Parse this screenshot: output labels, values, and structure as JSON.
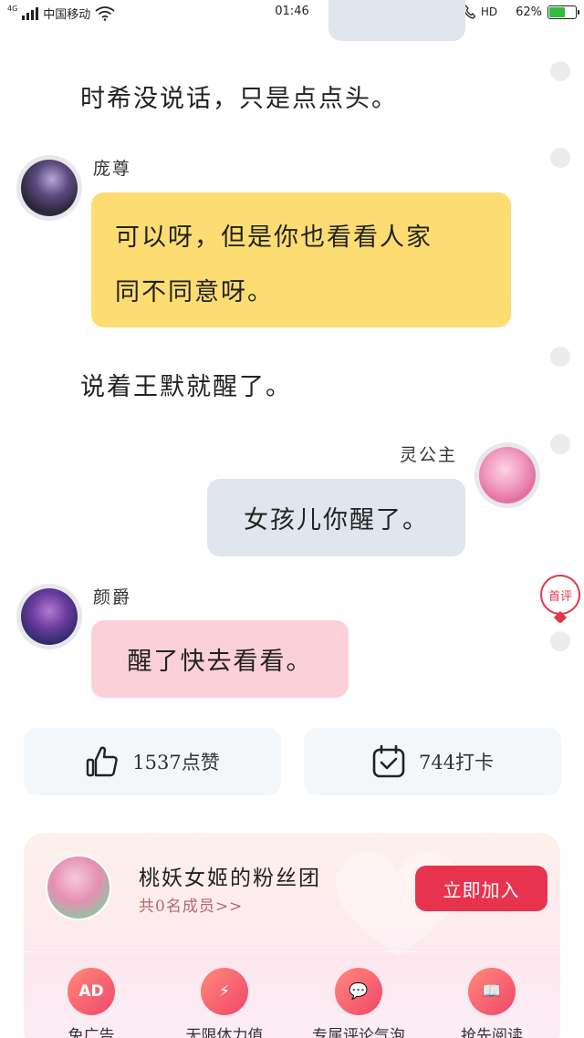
{
  "status_bar": {
    "network": "4G",
    "carrier": "中国移动",
    "time": "01:46",
    "hd_label": "HD",
    "battery": "62%",
    "battery_level": 0.62,
    "battery_color": "#2dbe3c"
  },
  "messages": {
    "narration_1": "时希没说话，只是点点头。",
    "msg_1": {
      "speaker": "庞尊",
      "text_line1": "可以呀，但是你也看看人家",
      "text_line2": "同不同意呀。",
      "bubble_color": "#fddd72"
    },
    "narration_2": "说着王默就醒了。",
    "msg_2": {
      "speaker": "灵公主",
      "text": "女孩儿你醒了。",
      "bubble_color": "#dfe6ed"
    },
    "msg_3": {
      "speaker": "颜爵",
      "text": "醒了快去看看。",
      "bubble_color": "#fbd0d9"
    }
  },
  "first_comment_badge": "首评",
  "stats": {
    "likes": "1537点赞",
    "checkins": "744打卡"
  },
  "fan_club": {
    "title": "桃妖女姬的粉丝团",
    "subtitle": "共0名成员>>",
    "join_label": "立即加入",
    "features": [
      {
        "icon": "ad-icon",
        "glyph": "AD",
        "label": "免广告"
      },
      {
        "icon": "lightning-icon",
        "glyph": "⚡",
        "label": "无限体力值"
      },
      {
        "icon": "chat-bubble-icon",
        "glyph": "💬",
        "label": "专属评论气泡"
      },
      {
        "icon": "book-icon",
        "glyph": "📖",
        "label": "抢先阅读"
      }
    ]
  },
  "colors": {
    "accent": "#e8334f",
    "first_comment": "#e3354a"
  }
}
